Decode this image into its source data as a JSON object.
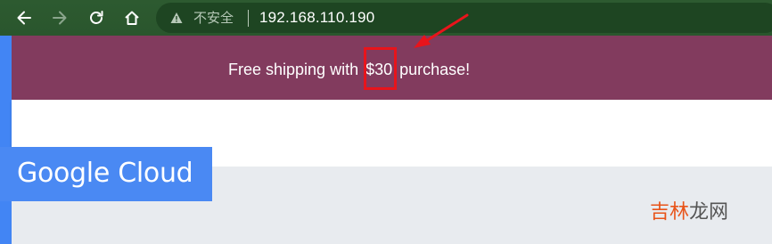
{
  "browser": {
    "security_label": "不安全",
    "url": "192.168.110.190"
  },
  "promo": {
    "text_before": "Free shipping with ",
    "price": "$30",
    "text_after": " purchase!"
  },
  "logo": {
    "text": "Google Cloud"
  },
  "watermark": {
    "part1": "吉林",
    "part2": "龙网"
  },
  "colors": {
    "browser_chrome": "#2d5a30",
    "omnibox": "#1e4522",
    "promo_banner": "#823b5e",
    "accent_blue": "#4285f4",
    "highlight_red": "#e8141b",
    "content_bg": "#e8ebef"
  }
}
